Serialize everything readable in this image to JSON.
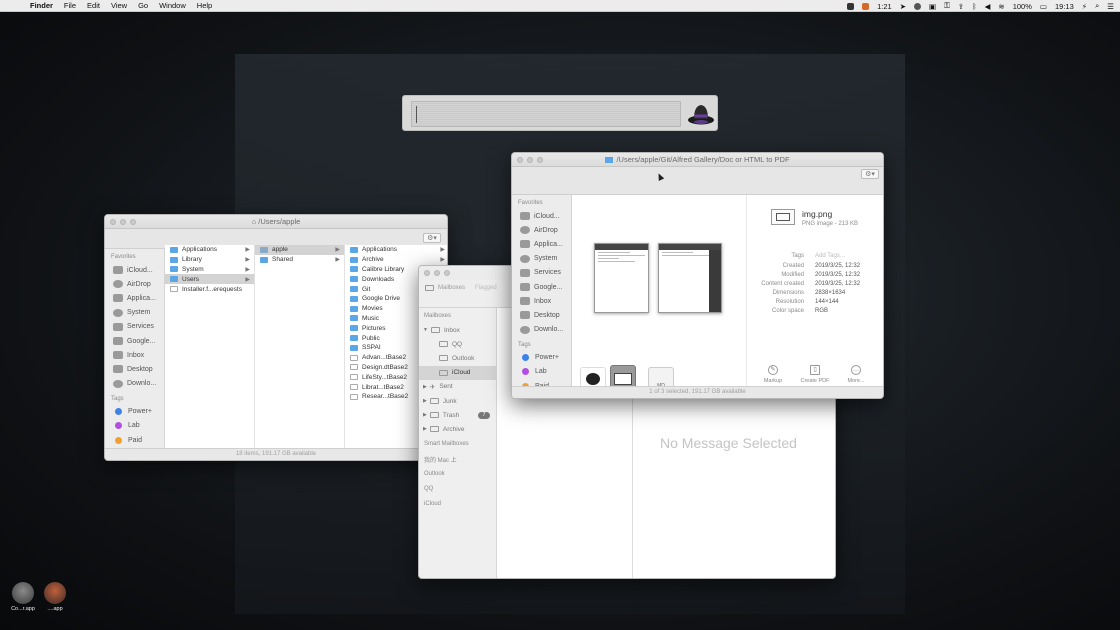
{
  "menubar": {
    "apple": "",
    "app": "Finder",
    "menus": [
      "File",
      "Edit",
      "View",
      "Go",
      "Window",
      "Help"
    ],
    "status_timer": "1:21",
    "battery": "100%",
    "time": "19:13"
  },
  "alfred": {
    "query": ""
  },
  "finder1": {
    "title": "/Users/apple",
    "favorites_header": "Favorites",
    "favorites": [
      "iCloud...",
      "AirDrop",
      "Applica...",
      "System",
      "Services",
      "Google...",
      "Inbox",
      "Desktop",
      "Downlo..."
    ],
    "tags_header": "Tags",
    "tags": [
      {
        "label": "Power+",
        "color": "#3c82e8"
      },
      {
        "label": "Lab",
        "color": "#b04fe0"
      },
      {
        "label": "Paid",
        "color": "#f0a030"
      }
    ],
    "col1": [
      "Applications",
      "Library",
      "System",
      "Users",
      "Installer.f...erequests"
    ],
    "col2": [
      "apple",
      "Shared"
    ],
    "col3": [
      "Applications",
      "Archive",
      "Calibre Library",
      "Downloads",
      "Git",
      "Google Drive",
      "Movies",
      "Music",
      "Pictures",
      "Public",
      "SSPAI",
      "Advan...tBase2",
      "Design.dtBase2",
      "LifeSty...tBase2",
      "Librat...tBase2",
      "Resear...tBase2"
    ],
    "status": "18 items, 191.17 GB available"
  },
  "mail": {
    "mailboxes_btn": "Mailboxes",
    "flagged_btn": "Flagged",
    "mailboxes_header": "Mailboxes",
    "inbox": "Inbox",
    "accounts": [
      "QQ",
      "Outlook",
      "iCloud"
    ],
    "folders": [
      {
        "label": "Sent"
      },
      {
        "label": "Junk"
      },
      {
        "label": "Trash",
        "badge": "7"
      },
      {
        "label": "Archive"
      }
    ],
    "smart_header": "Smart Mailboxes",
    "mac_label": "我的 Mac 上",
    "sections": [
      "Outlook",
      "QQ",
      "iCloud"
    ],
    "no_message": "No Message Selected"
  },
  "finder2": {
    "title": "/Users/apple/Git/Alfred Gallery/Doc or HTML to PDF",
    "favorites_header": "Favorites",
    "favorites": [
      "iCloud...",
      "AirDrop",
      "Applica...",
      "System",
      "Services",
      "Google...",
      "Inbox",
      "Desktop",
      "Downlo..."
    ],
    "tags_header": "Tags",
    "tags": [
      {
        "label": "Power+",
        "color": "#3c82e8"
      },
      {
        "label": "Lab",
        "color": "#b04fe0"
      },
      {
        "label": "Paid",
        "color": "#f0a030"
      }
    ],
    "strip_thumb_label": "MD",
    "file_name": "img.png",
    "file_kind": "PNG image - 213 KB",
    "meta": [
      {
        "k": "Tags",
        "v": "Add Tags..."
      },
      {
        "k": "Created",
        "v": "2019/3/25, 12:32"
      },
      {
        "k": "Modified",
        "v": "2019/3/25, 12:32"
      },
      {
        "k": "Content created",
        "v": "2019/3/25, 12:32"
      },
      {
        "k": "Dimensions",
        "v": "2838×1634"
      },
      {
        "k": "Resolution",
        "v": "144×144"
      },
      {
        "k": "Color space",
        "v": "RGB"
      }
    ],
    "actions": [
      "Markup",
      "Create PDF",
      "More..."
    ],
    "status": "1 of 3 selected, 191.17 GB available"
  },
  "dock": [
    {
      "label": "Co...r.app"
    },
    {
      "label": "....app"
    }
  ]
}
